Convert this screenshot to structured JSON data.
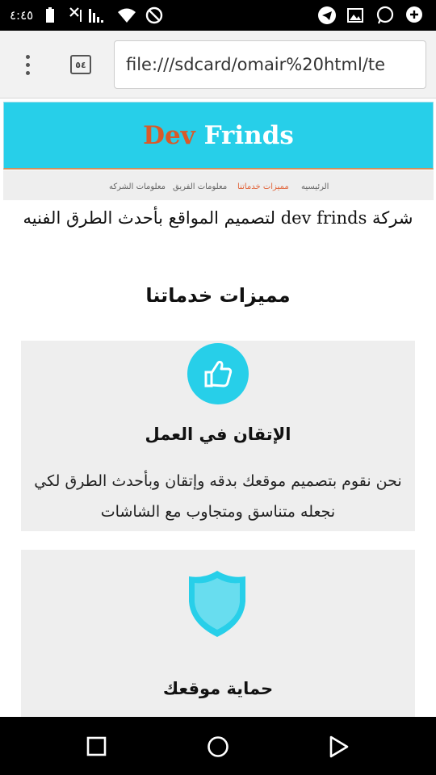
{
  "status_bar": {
    "time": "٤:٤٥",
    "left_icons": [
      "battery-icon",
      "signal-off-icon",
      "signal-icon",
      "wifi-icon",
      "do-not-disturb-icon"
    ],
    "right_icons": [
      "telegram-icon",
      "image-icon",
      "whatsapp-icon",
      "notification-icon"
    ]
  },
  "browser": {
    "tab_count": "٥٤",
    "url": "file:///sdcard/omair%20html/te"
  },
  "site": {
    "logo_part1": "Dev",
    "logo_part2": "Frinds",
    "nav": [
      {
        "label": "الرئيسيه",
        "active": false
      },
      {
        "label": "مميزات خدماتنا",
        "active": true
      },
      {
        "label": "معلومات الفريق",
        "active": false
      },
      {
        "label": "معلومات الشركه",
        "active": false
      }
    ],
    "intro": "شركة dev frinds لتصميم المواقع بأحدث الطرق الفنيه",
    "section_title": "مميزات خدماتنا",
    "features": [
      {
        "icon": "thumbs-up-icon",
        "title": "الإتقان في العمل",
        "text": "نحن نقوم بتصميم موقعك بدقه وإتقان وبأحدث الطرق لكي نجعله متناسق ومتجاوب مع الشاشات"
      },
      {
        "icon": "shield-icon",
        "title": "حماية موقعك"
      }
    ]
  },
  "colors": {
    "header_bg": "#27cfe9",
    "logo_accent": "#d85a2a",
    "nav_active": "#e1643a",
    "card_bg": "#eeeeee"
  },
  "android_nav": [
    "recent-apps-icon",
    "home-icon",
    "back-icon"
  ]
}
